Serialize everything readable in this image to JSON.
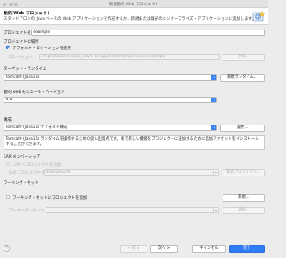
{
  "window": {
    "title": "新規動的 Web プロジェクト"
  },
  "header": {
    "title": "動的 Web プロジェクト",
    "description": "スタンドアロンの Java ベースの Web アプリケーションを作成するか、新規または既存のエンタープライズ・アプリケーションに追加します。",
    "icon": "web-project-wizard-icon"
  },
  "project_name": {
    "label": "プロジェクト名:",
    "value": "example"
  },
  "location": {
    "section_label": "プロジェクトの場所",
    "use_default_label": "デフォルト・ロケーションを使用",
    "use_default_checked": true,
    "location_label": "ロケーション:",
    "location_value": "/Applications/Eclipse_2021-12.app/Contents/workspace/example",
    "browse_label": "参照..."
  },
  "runtime": {
    "section_label": "ターゲット・ランタイム",
    "selected": "Tomcat9 (Java11)",
    "new_runtime_label": "新規ランタイム..."
  },
  "module_version": {
    "section_label": "動的 web モジュール・バージョン",
    "selected": "4.0"
  },
  "configuration": {
    "section_label": "構成",
    "selected": "Tomcat9 (Java11) デフォルト構成",
    "change_label": "変更...",
    "description": "Tomcat9 (Java11) ランタイムを操作するための良い出発点です。後で新しい機能をプロジェクトに追加するために追加ファセットをインストールすることができます。"
  },
  "ear": {
    "section_label": "EAR メンバーシップ",
    "add_label": "EAR へプロジェクトを追加",
    "add_checked": false,
    "ear_project_label": "EAR プロジェクト名:",
    "ear_project_value": "exampleEAR",
    "new_project_label": "新規プロジェクト..."
  },
  "working_set": {
    "section_label": "ワーキング・セット",
    "add_label": "ワーキング・セットにプロジェクトを追加",
    "add_checked": false,
    "new_label": "新規...",
    "working_sets_label": "ワーキング・セット:",
    "select_label": "選択..."
  },
  "footer": {
    "help_label": "?",
    "back_label": "< 戻る",
    "next_label": "次へ >",
    "cancel_label": "キャンセル",
    "finish_label": "完了"
  }
}
